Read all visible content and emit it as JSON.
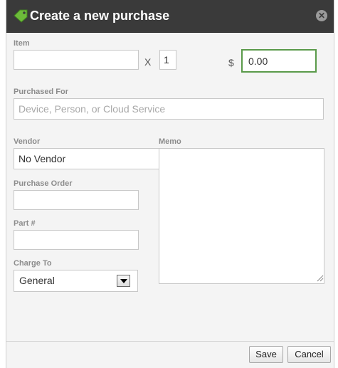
{
  "dialog": {
    "title": "Create a new purchase",
    "close_glyph": "✕",
    "icons": {
      "title": "tag-icon",
      "close": "close-icon"
    }
  },
  "form": {
    "item": {
      "label": "Item",
      "value": "",
      "placeholder": ""
    },
    "times_glyph": "X",
    "quantity": {
      "value": "1"
    },
    "currency_symbol": "$",
    "price": {
      "value": "0.00"
    },
    "purchased_for": {
      "label": "Purchased For",
      "value": "",
      "placeholder": "Device, Person, or Cloud Service"
    },
    "vendor": {
      "label": "Vendor",
      "value": "No Vendor"
    },
    "memo": {
      "label": "Memo",
      "value": ""
    },
    "purchase_order": {
      "label": "Purchase Order",
      "value": ""
    },
    "part_number": {
      "label": "Part #",
      "value": ""
    },
    "charge_to": {
      "label": "Charge To",
      "selected": "General"
    }
  },
  "buttons": {
    "save": "Save",
    "cancel": "Cancel"
  },
  "colors": {
    "titlebar": "#3a3a3a",
    "focus_border": "#5a9a4a",
    "label": "#8c8c8c"
  }
}
